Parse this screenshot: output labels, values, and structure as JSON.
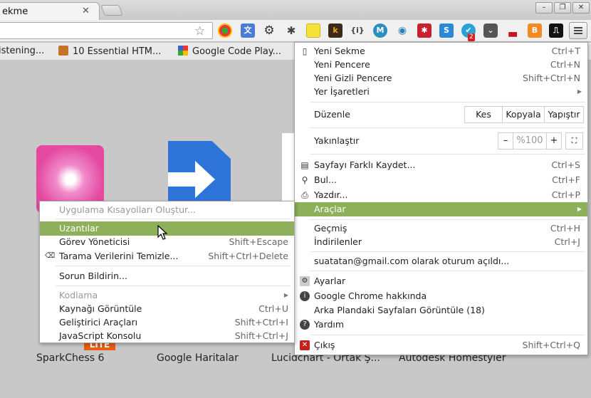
{
  "tab": {
    "title": "ekme"
  },
  "bookmarks": [
    {
      "label": "istening..."
    },
    {
      "label": "10 Essential HTM..."
    },
    {
      "label": "Google Code Play..."
    }
  ],
  "toolbar": {
    "extensions": [
      "webcam-icon",
      "translate-icon",
      "gear-icon",
      "bug-icon",
      "sticky-note-icon",
      "k-icon",
      "json-icon",
      "m-icon",
      "eye-icon",
      "lastpass-icon",
      "s-icon",
      "email-icon",
      "pocket-icon",
      "car-icon",
      "blogger-icon",
      "waveform-icon"
    ],
    "email_badge": "2"
  },
  "apps": [
    {
      "label": "SparkChess 6"
    },
    {
      "label": "Google Haritalar"
    },
    {
      "label": "Lucidchart - Ortak Ş..."
    },
    {
      "label": "Autodesk Homestyler"
    }
  ],
  "main_menu": {
    "new_tab": {
      "label": "Yeni Sekme",
      "shortcut": "Ctrl+T"
    },
    "new_window": {
      "label": "Yeni Pencere",
      "shortcut": "Ctrl+N"
    },
    "incognito": {
      "label": "Yeni Gizli Pencere",
      "shortcut": "Shift+Ctrl+N"
    },
    "bookmarks": {
      "label": "Yer İşaretleri"
    },
    "edit": {
      "label": "Düzenle",
      "cut": "Kes",
      "copy": "Kopyala",
      "paste": "Yapıştır"
    },
    "zoom": {
      "label": "Yakınlaştır",
      "minus": "–",
      "value": "%100",
      "plus": "+"
    },
    "save_page": {
      "label": "Sayfayı Farklı Kaydet...",
      "shortcut": "Ctrl+S"
    },
    "find": {
      "label": "Bul...",
      "shortcut": "Ctrl+F"
    },
    "print": {
      "label": "Yazdır...",
      "shortcut": "Ctrl+P"
    },
    "tools": {
      "label": "Araçlar"
    },
    "history": {
      "label": "Geçmiş",
      "shortcut": "Ctrl+H"
    },
    "downloads": {
      "label": "İndirilenler",
      "shortcut": "Ctrl+J"
    },
    "signed_in": {
      "label": "suatatan@gmail.com olarak oturum açıldı..."
    },
    "settings": {
      "label": "Ayarlar"
    },
    "about": {
      "label": "Google Chrome hakkında"
    },
    "background_pages": {
      "label": "Arka Plandaki Sayfaları Görüntüle (18)"
    },
    "help": {
      "label": "Yardım"
    },
    "exit": {
      "label": "Çıkış",
      "shortcut": "Shift+Ctrl+Q"
    }
  },
  "tools_menu": {
    "create_shortcuts": {
      "label": "Uygulama Kısayolları Oluştur..."
    },
    "extensions": {
      "label": "Uzantılar"
    },
    "task_manager": {
      "label": "Görev Yöneticisi",
      "shortcut": "Shift+Escape"
    },
    "clear_data": {
      "label": "Tarama Verilerini Temizle...",
      "shortcut": "Shift+Ctrl+Delete"
    },
    "report_issue": {
      "label": "Sorun Bildirin..."
    },
    "encoding": {
      "label": "Kodlama"
    },
    "view_source": {
      "label": "Kaynağı Görüntüle",
      "shortcut": "Ctrl+U"
    },
    "dev_tools": {
      "label": "Geliştirici Araçları",
      "shortcut": "Shift+Ctrl+I"
    },
    "js_console": {
      "label": "JavaScript Konsolu",
      "shortcut": "Shift+Ctrl+J"
    }
  },
  "app_badge": "LITE",
  "colors": {
    "highlight": "#8eb05b"
  }
}
